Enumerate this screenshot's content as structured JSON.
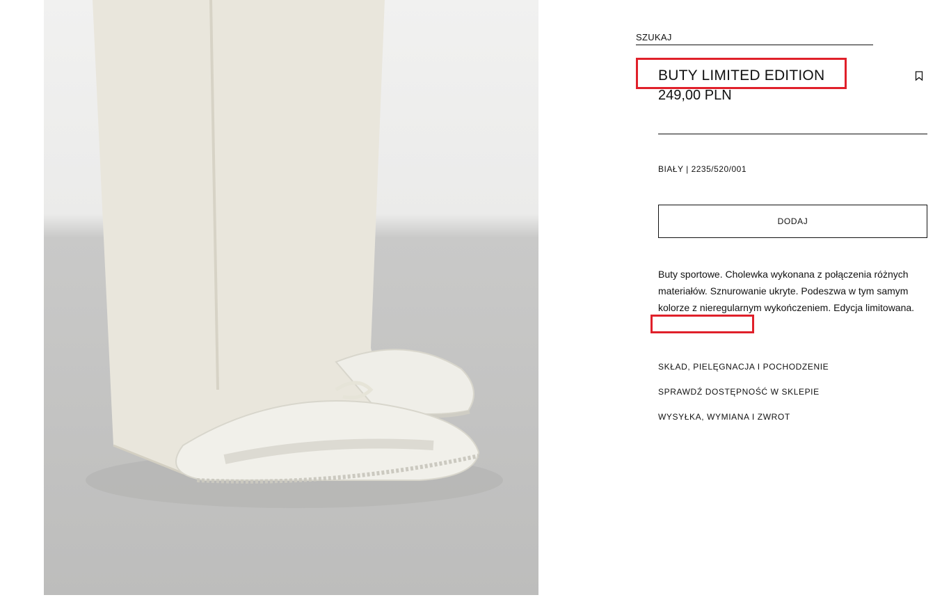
{
  "search": {
    "label": "SZUKAJ"
  },
  "product": {
    "title": "BUTY LIMITED EDITION",
    "price": "249,00 PLN",
    "color_ref": "BIAŁY | 2235/520/001",
    "add_button": "DODAJ",
    "description_main": "Buty sportowe. Cholewka wykonana z połączenia różnych materiałów. Sznurowanie ukryte. Podeszwa w tym samym kolorze z nieregularnym wykończeniem.",
    "description_limited": "Edycja limitowana.",
    "bookmark_icon": "bookmark-icon"
  },
  "info_links": [
    "SKŁAD, PIELĘGNACJA I POCHODZENIE",
    "SPRAWDŹ DOSTĘPNOŚĆ W SKLEPIE",
    "WYSYŁKA, WYMIANA I ZWROT"
  ],
  "colors": {
    "text": "#111111",
    "highlight": "#e0202a",
    "background": "#ffffff"
  }
}
